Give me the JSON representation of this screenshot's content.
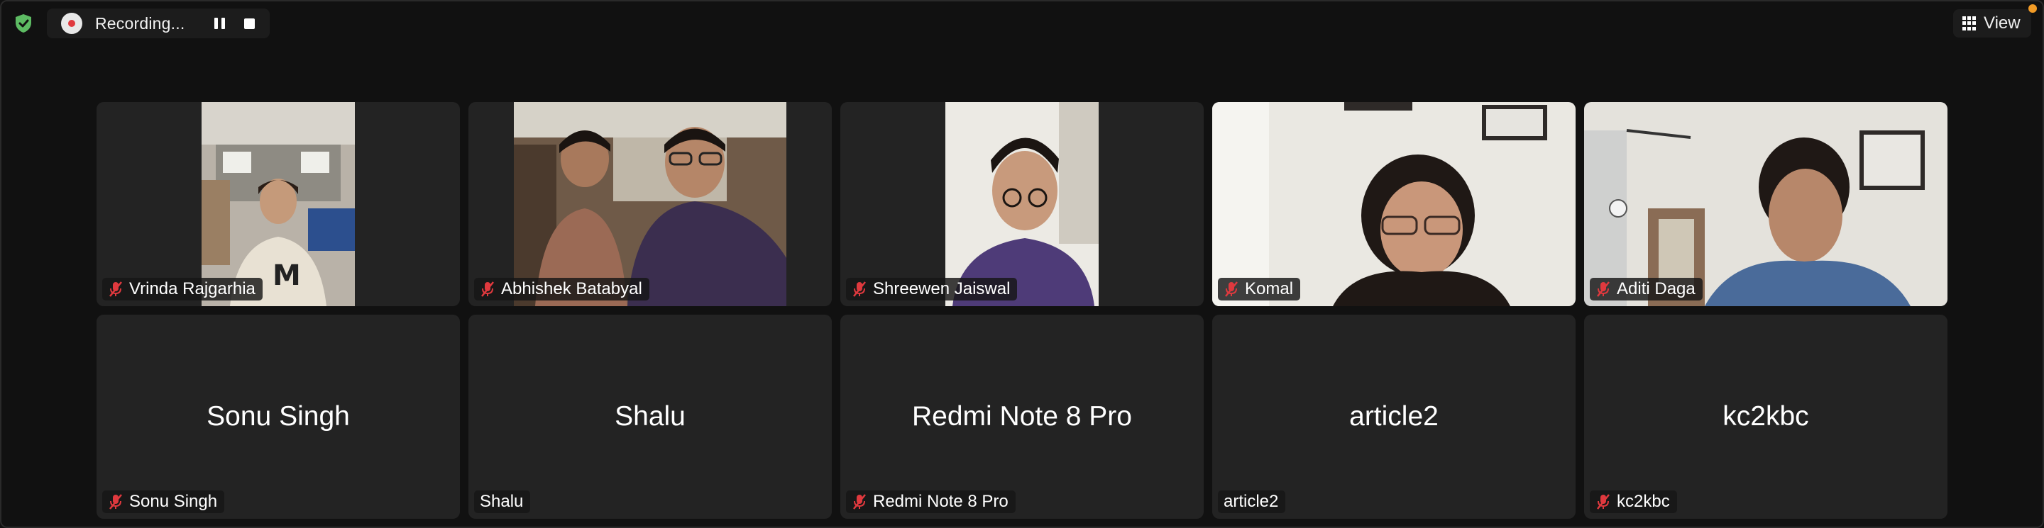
{
  "toolbar": {
    "recording_label": "Recording...",
    "view_label": "View",
    "colors": {
      "recording_dot": "#e0393e",
      "shield": "#5dbb63",
      "notification": "#f29b26"
    }
  },
  "participants": [
    {
      "name": "Vrinda Rajgarhia",
      "video": "on",
      "muted": true
    },
    {
      "name": "Abhishek Batabyal",
      "video": "on",
      "muted": true
    },
    {
      "name": "Shreewen Jaiswal",
      "video": "on",
      "muted": true
    },
    {
      "name": "Komal",
      "video": "on",
      "muted": true
    },
    {
      "name": "Aditi Daga",
      "video": "on",
      "muted": true
    },
    {
      "name": "Sonu Singh",
      "display_name": "Sonu Singh",
      "video": "off",
      "muted": true
    },
    {
      "name": "Shalu",
      "display_name": "Shalu",
      "video": "off",
      "muted": false
    },
    {
      "name": "Redmi Note 8 Pro",
      "display_name": "Redmi Note 8 Pro",
      "video": "off",
      "muted": true
    },
    {
      "name": "article2",
      "display_name": "article2",
      "video": "off",
      "muted": false
    },
    {
      "name": "kc2kbc",
      "display_name": "kc2kbc",
      "video": "off",
      "muted": true
    }
  ]
}
